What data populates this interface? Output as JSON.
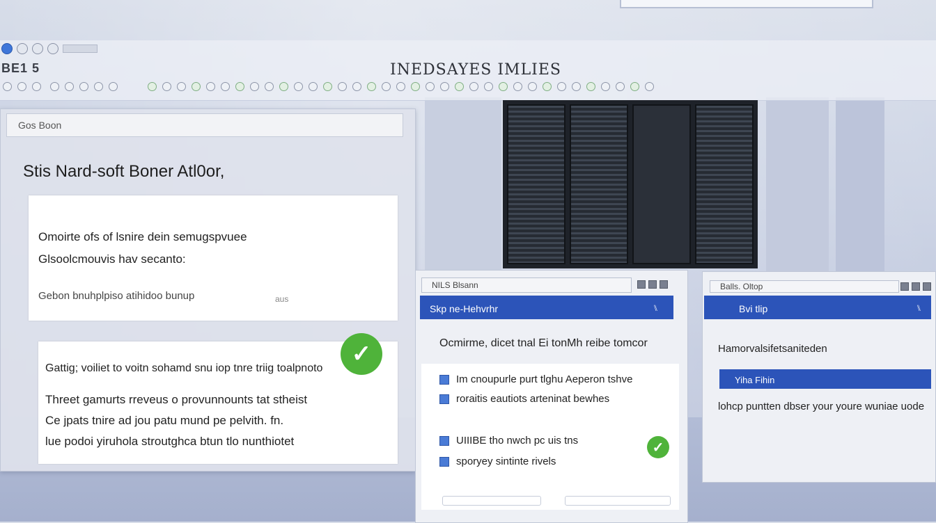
{
  "header": {
    "left_text": "BE1 5",
    "title": "INEDSAYES IMLIES"
  },
  "main_panel": {
    "titlebar": "Gos Boon",
    "heading": "Stis Nard-soft Boner Atl0or,",
    "card1": {
      "line1": "Omoirte ofs of lsnire dein semugspvuee",
      "line2": "Glsoolcmouvis hav secanto:",
      "line3": "Gebon bnuhplpiso atihidoo bunup",
      "note": "aus"
    },
    "card2": {
      "line1": "Gattig; voiliet to voitn sohamd snu iop tnre triig toalpnoto",
      "line2": "Threet gamurts rreveus o provunnounts tat stheist",
      "line3": "Ce jpats tnire ad jou patu mund pe pelvith. fn.",
      "line4": "lue podoi yiruhola stroutghca btun tlo nunthiotet"
    }
  },
  "mid_panel": {
    "titlebar": "NILS Blsann",
    "bar_label": "Skp ne-Hehvrhr",
    "bar_icon": "⑊",
    "intro": "Ocmirme, dicet tnal Ei tonMh reibe tomcor",
    "items": [
      "Im cnoupurle purt tlghu Aeperon tshve",
      "roraitis eautiots arteninat bewhes",
      "UIIIBE tho nwch pc uis tns",
      "sporyey sintinte rivels"
    ]
  },
  "right_panel": {
    "titlebar": "Balls. Oltop",
    "bar_label": "Bvi tlip",
    "bar_icon": "⑊",
    "heading": "Hamorvalsifetsaniteden",
    "select_value": "Yiha Fihin",
    "text": "lohcp puntten dbser your youre wuniae uode"
  },
  "colors": {
    "accent_blue": "#2c54b9",
    "check_green": "#4fb33a"
  },
  "icons": [
    "check-circle-icon",
    "list-square-icon",
    "window-button-icon"
  ]
}
